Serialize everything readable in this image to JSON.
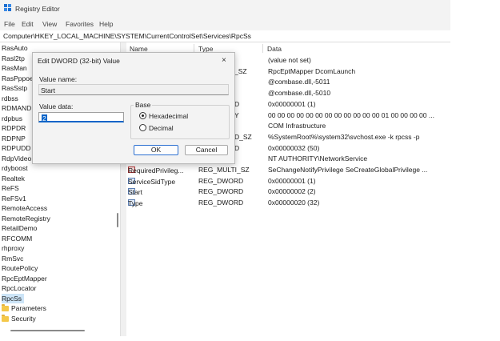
{
  "window": {
    "title": "Registry Editor"
  },
  "menu": [
    "File",
    "Edit",
    "View",
    "Favorites",
    "Help"
  ],
  "address": "Computer\\HKEY_LOCAL_MACHINE\\SYSTEM\\CurrentControlSet\\Services\\RpcSs",
  "tree": {
    "items": [
      {
        "label": "RasAuto"
      },
      {
        "label": "Rasl2tp"
      },
      {
        "label": "RasMan"
      },
      {
        "label": "RasPppoe"
      },
      {
        "label": "RasSstp"
      },
      {
        "label": "rdbss"
      },
      {
        "label": "RDMANDI"
      },
      {
        "label": "rdpbus"
      },
      {
        "label": "RDPDR"
      },
      {
        "label": "RDPNP"
      },
      {
        "label": "RDPUDD"
      },
      {
        "label": "RdpVideo"
      },
      {
        "label": "rdyboost"
      },
      {
        "label": "Realtek"
      },
      {
        "label": "ReFS"
      },
      {
        "label": "ReFSv1"
      },
      {
        "label": "RemoteAccess"
      },
      {
        "label": "RemoteRegistry"
      },
      {
        "label": "RetailDemo"
      },
      {
        "label": "RFCOMM"
      },
      {
        "label": "rhproxy"
      },
      {
        "label": "RmSvc"
      },
      {
        "label": "RoutePolicy"
      },
      {
        "label": "RpcEptMapper"
      },
      {
        "label": "RpcLocator"
      },
      {
        "label": "RpcSs"
      }
    ],
    "children": [
      {
        "label": "Parameters"
      },
      {
        "label": "Security"
      }
    ]
  },
  "columns": {
    "name": "Name",
    "type": "Type",
    "data": "Data"
  },
  "rows": [
    {
      "name": "",
      "type": "",
      "data": "(value not set)"
    },
    {
      "name": "",
      "type": "_SZ",
      "data": "RpcEptMapper DcomLaunch"
    },
    {
      "name": "",
      "type": "",
      "data": "@combase.dll,-5011"
    },
    {
      "name": "",
      "type": "",
      "data": "@combase.dll,-5010"
    },
    {
      "name": "",
      "type": "D",
      "data": "0x00000001 (1)"
    },
    {
      "name": "",
      "type": "Y",
      "data": "00 00 00 00 00 00 00 00 00 00 00 00 01 00 00 00 00 ..."
    },
    {
      "name": "",
      "type": "",
      "data": "COM Infrastructure"
    },
    {
      "name": "",
      "type": "D_SZ",
      "data": "%SystemRoot%\\system32\\svchost.exe -k rpcss -p"
    },
    {
      "name": "",
      "type": "D",
      "data": "0x00000032 (50)"
    },
    {
      "name": "",
      "type": "",
      "data": "NT AUTHORITY\\NetworkService"
    },
    {
      "name": "RequiredPrivileg...",
      "type": "REG_MULTI_SZ",
      "data": "SeChangeNotifyPrivilege SeCreateGlobalPrivilege ..."
    },
    {
      "name": "ServiceSidType",
      "type": "REG_DWORD",
      "data": "0x00000001 (1)"
    },
    {
      "name": "Start",
      "type": "REG_DWORD",
      "data": "0x00000002 (2)"
    },
    {
      "name": "Type",
      "type": "REG_DWORD",
      "data": "0x00000020 (32)"
    }
  ],
  "dialog": {
    "title": "Edit DWORD (32-bit) Value",
    "close": "×",
    "value_name_label": "Value name:",
    "value_name": "Start",
    "value_data_label": "Value data:",
    "value_data": "2",
    "base_label": "Base",
    "hex_label": "Hexadecimal",
    "dec_label": "Decimal",
    "ok": "OK",
    "cancel": "Cancel"
  }
}
